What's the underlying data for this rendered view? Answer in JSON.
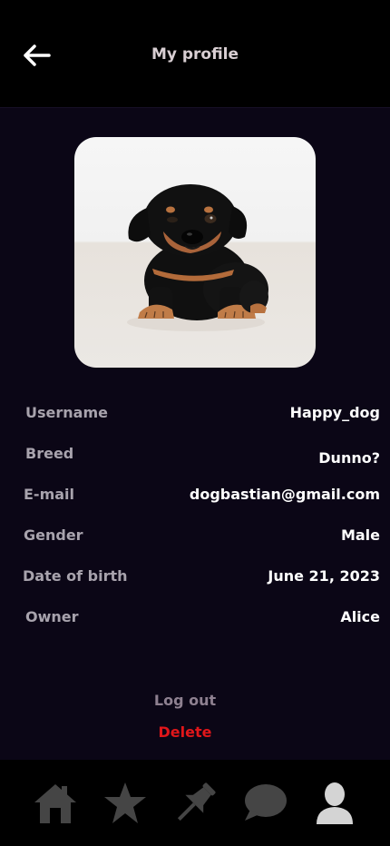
{
  "header": {
    "title": "My profile",
    "back_icon": "arrow-left-icon"
  },
  "profile": {
    "photo": "dachshund-puppy-photo",
    "fields": {
      "username": {
        "label": "Username",
        "value": "Happy_dog"
      },
      "breed": {
        "label": "Breed",
        "value": "Dunno?"
      },
      "email": {
        "label": "E-mail",
        "value": "dogbastian@gmail.com"
      },
      "gender": {
        "label": "Gender",
        "value": "Male"
      },
      "dob": {
        "label": "Date of birth",
        "value": "June 21, 2023"
      },
      "owner": {
        "label": "Owner",
        "value": "Alice"
      }
    }
  },
  "actions": {
    "logout_label": "Log out",
    "delete_label": "Delete"
  },
  "nav": {
    "items": [
      {
        "icon": "home-icon"
      },
      {
        "icon": "star-icon"
      },
      {
        "icon": "pin-icon"
      },
      {
        "icon": "chat-bubble-icon"
      },
      {
        "icon": "user-icon",
        "active": true
      }
    ]
  },
  "colors": {
    "background": "#0b0616",
    "label": "#a8a3ad",
    "value": "#ffffff",
    "logout": "#8e8090",
    "delete": "#e0161a",
    "nav_inactive": "#454545",
    "nav_active": "#d4d4d4"
  }
}
